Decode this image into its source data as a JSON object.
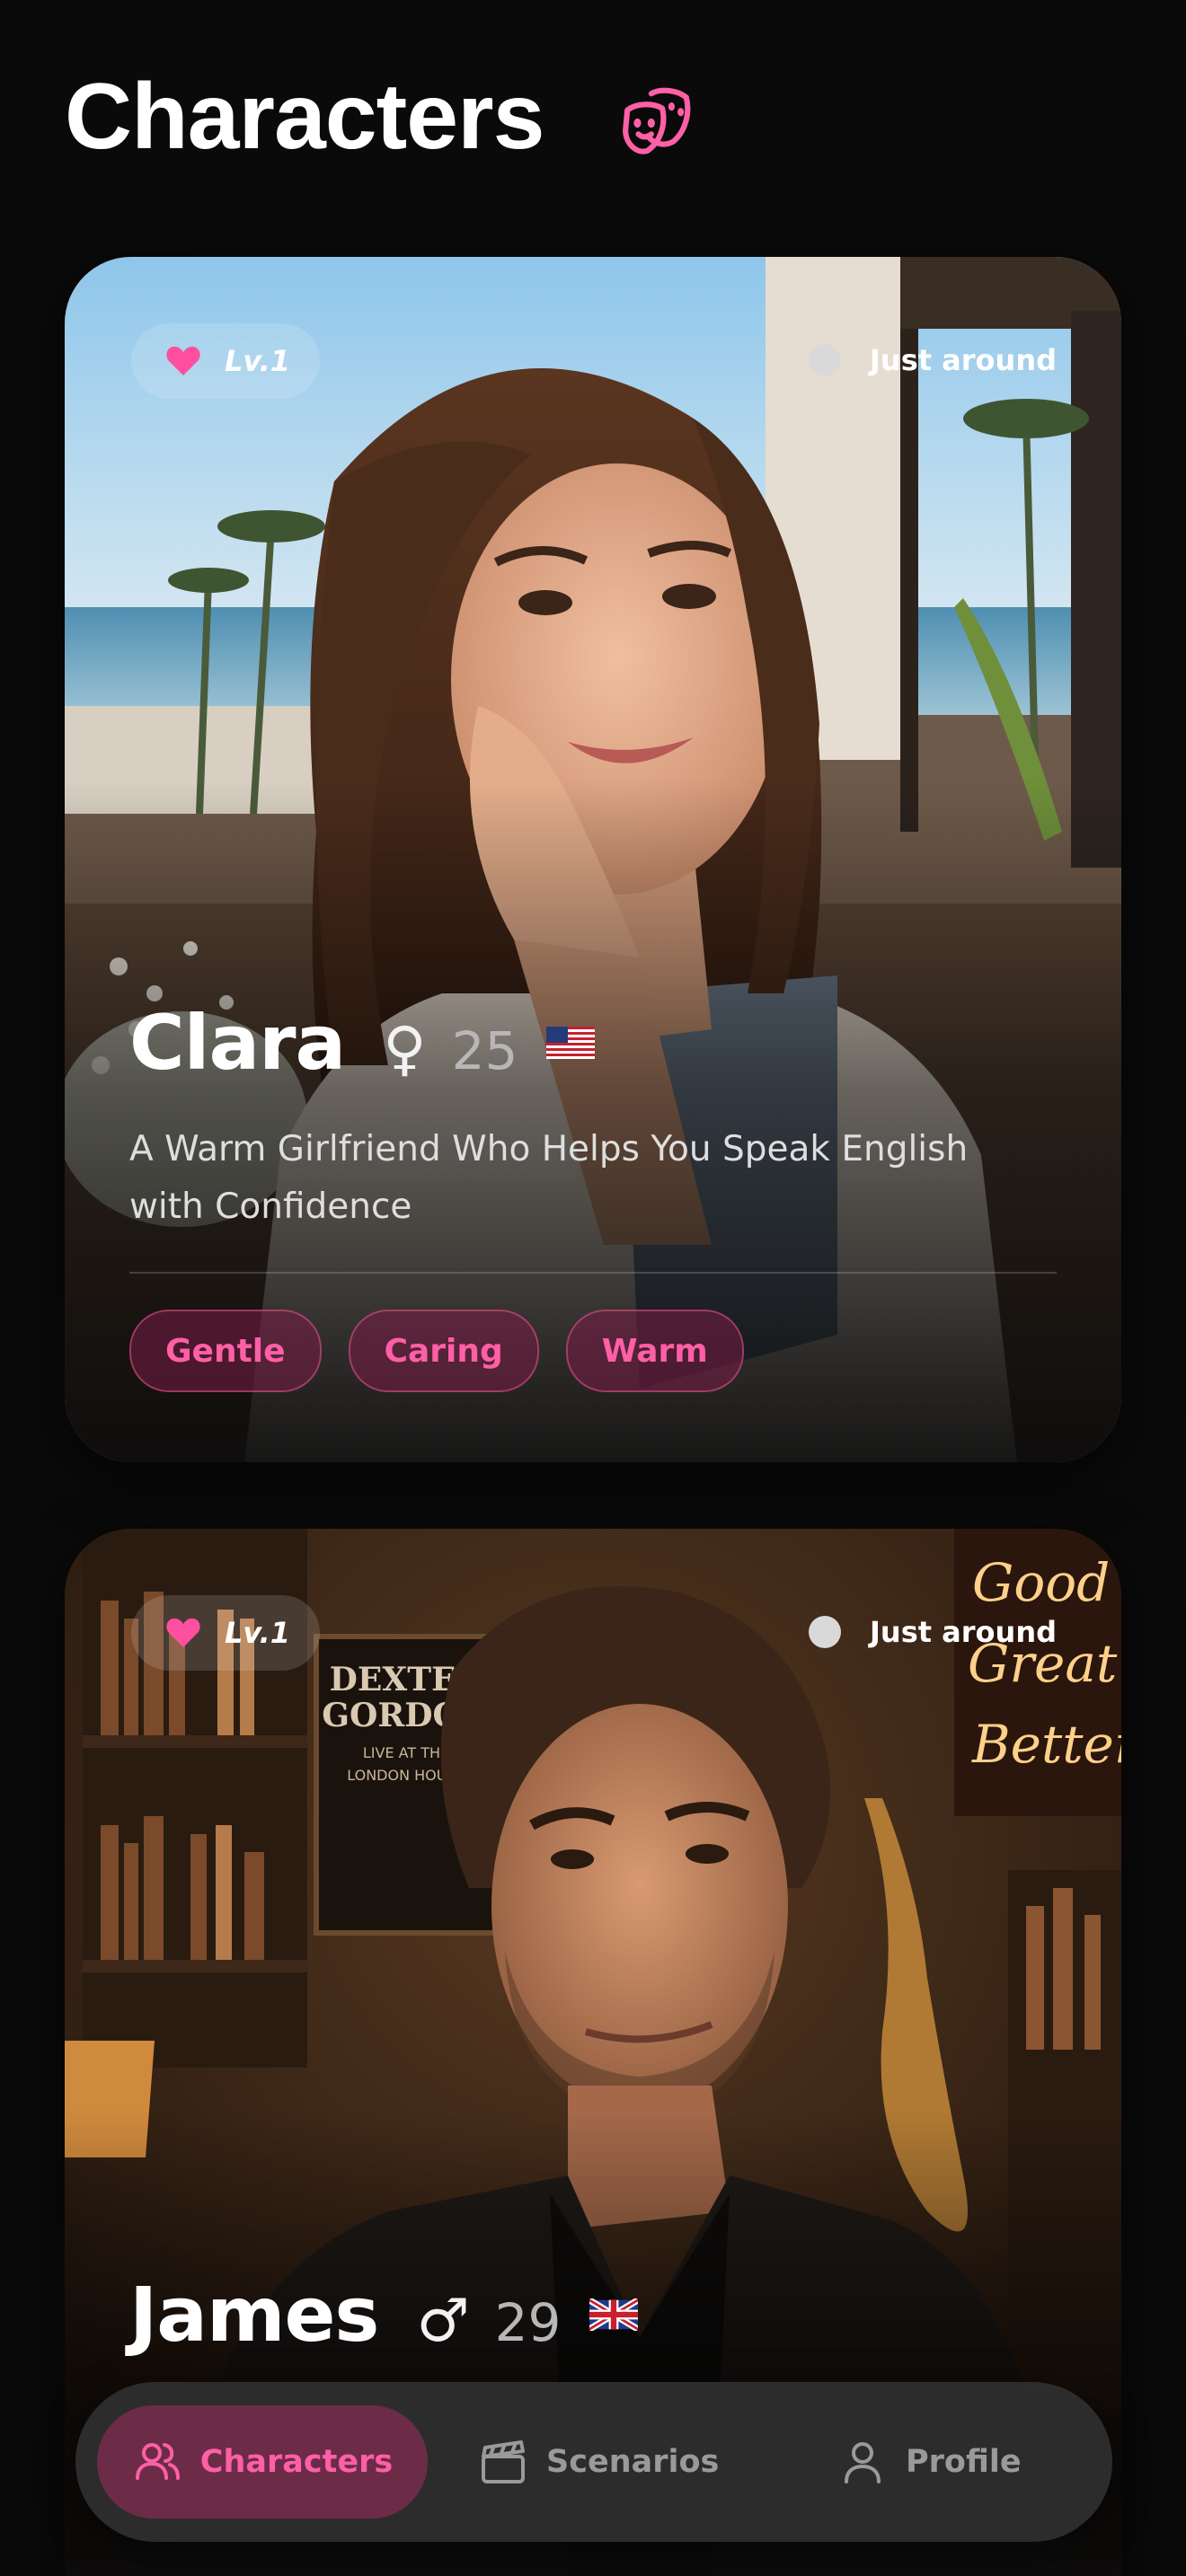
{
  "header": {
    "title": "Characters",
    "title_icon": "theater-masks-icon"
  },
  "accent": "#ff5fa6",
  "cards": [
    {
      "level": "Lv.1",
      "status": "Just around",
      "name": "Clara",
      "gender": "♀",
      "age": "25",
      "flag": "us-flag",
      "description": "A Warm Girlfriend Who Helps You Speak English with Confidence",
      "tags": [
        "Gentle",
        "Caring",
        "Warm"
      ]
    },
    {
      "level": "Lv.1",
      "status": "Just around",
      "name": "James",
      "gender": "♂",
      "age": "29",
      "flag": "uk-flag",
      "poster_text": [
        "DEXTER",
        "GORDON",
        "LIVE AT THE",
        "LONDON HOUSE"
      ],
      "neon_text": [
        "Good s",
        "Great m",
        "Better co"
      ]
    }
  ],
  "nav": {
    "items": [
      {
        "label": "Characters",
        "icon": "users-icon",
        "active": true
      },
      {
        "label": "Scenarios",
        "icon": "clapperboard-icon",
        "active": false
      },
      {
        "label": "Profile",
        "icon": "user-icon",
        "active": false
      }
    ]
  }
}
